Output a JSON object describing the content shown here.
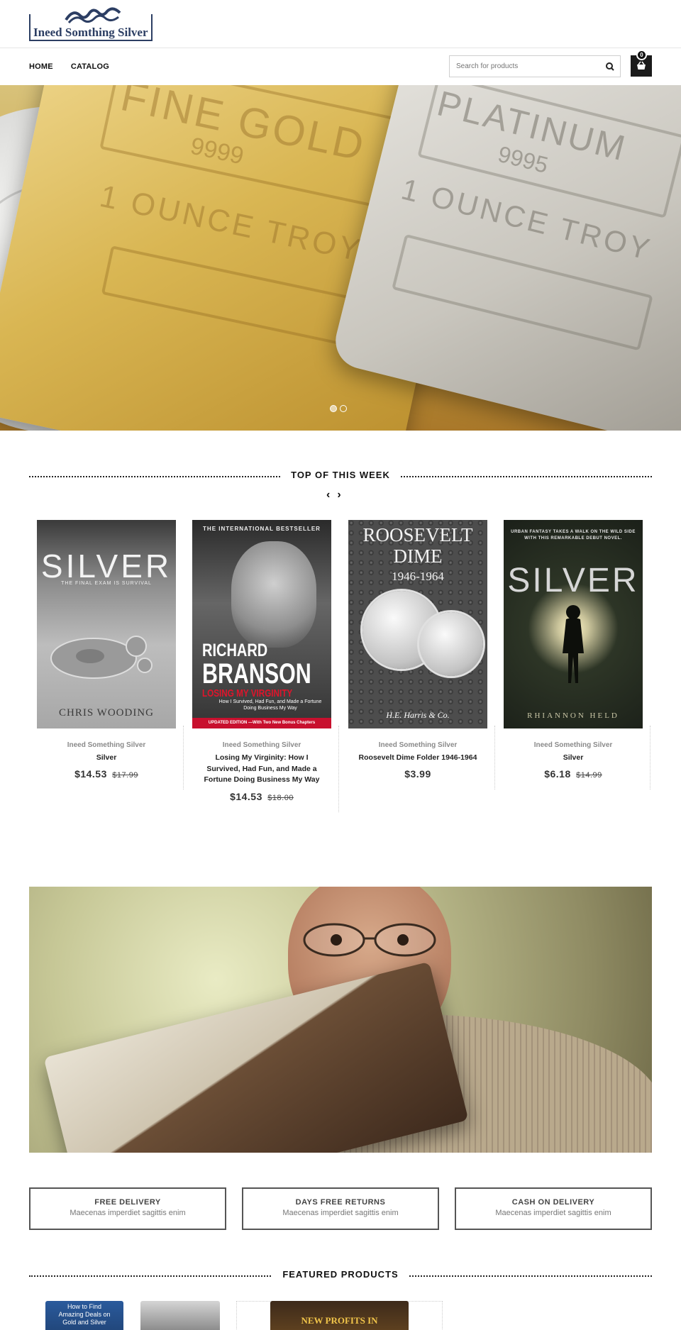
{
  "header": {
    "logo_text": "Ineed Somthing Silver",
    "nav": [
      {
        "label": "HOME"
      },
      {
        "label": "CATALOG"
      }
    ],
    "search_placeholder": "Search for products",
    "cart_count": "0"
  },
  "hero": {
    "gold_bar": {
      "line1": "FINE GOLD",
      "line2": "9999",
      "line3": "1 OUNCE TROY"
    },
    "platinum_bar": {
      "line1": "PLATINUM",
      "line2": "9995",
      "line3": "1 OUNCE TROY"
    },
    "slides": 2,
    "active_slide": 1
  },
  "top_week": {
    "title": "TOP OF THIS WEEK",
    "prev": "‹",
    "next": "›",
    "products": [
      {
        "vendor": "Ineed Something Silver",
        "name": "Silver",
        "price": "$14.53",
        "compare_price": "$17.99",
        "cover": {
          "title": "SILVER",
          "subtitle": "THE FINAL EXAM IS SURVIVAL",
          "author": "CHRIS WOODING"
        }
      },
      {
        "vendor": "Ineed Something Silver",
        "name": "Losing My Virginity: How I Survived, Had Fun, and Made a Fortune Doing Business My Way",
        "price": "$14.53",
        "compare_price": "$18.00",
        "cover": {
          "top": "THE INTERNATIONAL BESTSELLER",
          "author1": "RICHARD",
          "author2": "BRANSON",
          "title": "LOSING MY VIRGINITY",
          "subtitle": "How I Survived, Had Fun, and Made a Fortune Doing Business My Way",
          "edition": "UPDATED EDITION —With Two New Bonus Chapters"
        }
      },
      {
        "vendor": "Ineed Something Silver",
        "name": "Roosevelt Dime Folder 1946-1964",
        "price": "$3.99",
        "compare_price": "",
        "cover": {
          "title1": "ROOSEVELT",
          "title2": "DIME",
          "years": "1946-1964",
          "brand": "H.E. Harris & Co."
        }
      },
      {
        "vendor": "Ineed Something Silver",
        "name": "Silver",
        "price": "$6.18",
        "compare_price": "$14.99",
        "cover": {
          "top": "URBAN FANTASY TAKES A WALK ON THE WILD SIDE WITH THIS REMARKABLE DEBUT NOVEL.",
          "title": "SILVER",
          "author": "RHIANNON HELD"
        }
      }
    ]
  },
  "features": [
    {
      "title": "FREE DELIVERY",
      "text": "Maecenas imperdiet sagittis enim"
    },
    {
      "title": "DAYS FREE RETURNS",
      "text": "Maecenas imperdiet sagittis enim"
    },
    {
      "title": "CASH ON DELIVERY",
      "text": "Maecenas imperdiet sagittis enim"
    }
  ],
  "featured": {
    "title": "FEATURED PRODUCTS",
    "thumb1_text": "How to Find Amazing Deals on Gold and Silver",
    "thumb3_text": "NEW PROFITS IN"
  }
}
